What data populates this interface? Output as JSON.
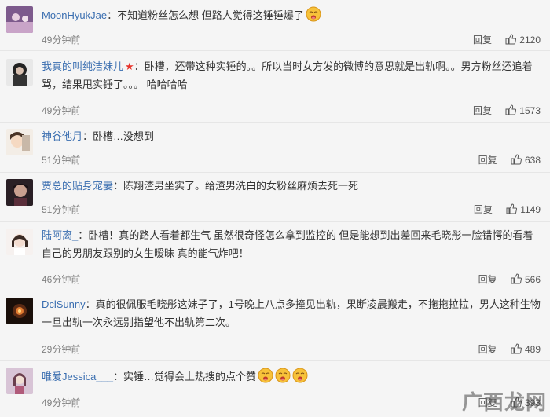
{
  "comments": [
    {
      "user": "MoonHyukJae",
      "text": "：不知道粉丝怎么想 但路人觉得这锤锤爆了",
      "time": "49分钟前",
      "reply": "回复",
      "likes": "2120",
      "emoji_count": 1
    },
    {
      "user": "我真的叫纯洁妹儿",
      "text": "：卧槽，还带这种实锤的。。所以当时女方发的微博的意思就是出轨啊。。男方粉丝还追着骂，结果甩实锤了。。。 哈哈哈哈",
      "time": "49分钟前",
      "reply": "回复",
      "likes": "1573",
      "badge": "★"
    },
    {
      "user": "神谷他月",
      "text": "：卧槽…没想到",
      "time": "51分钟前",
      "reply": "回复",
      "likes": "638"
    },
    {
      "user": "贾总的贴身宠妻",
      "text": "：陈翔渣男坐实了。给渣男洗白的女粉丝麻烦去死一死",
      "time": "51分钟前",
      "reply": "回复",
      "likes": "1149"
    },
    {
      "user": "陆阿离_",
      "text": "：卧槽！真的路人看着都生气 虽然很奇怪怎么拿到监控的 但是能想到出差回来毛晓彤一脸错愕的看着自己的男朋友跟别的女生暧昧 真的能气炸吧！",
      "time": "46分钟前",
      "reply": "回复",
      "likes": "566"
    },
    {
      "user": "DclSunny",
      "text": "：真的很佩服毛晓彤这妹子了，1号晚上八点多撞见出轨，果断凌晨搬走，不拖拖拉拉，男人这种生物一旦出轨一次永远别指望他不出轨第二次。",
      "time": "29分钟前",
      "reply": "回复",
      "likes": "489"
    },
    {
      "user": "唯爱Jessica___",
      "text": "：实锤…觉得会上热搜的点个赞",
      "time": "49分钟前",
      "reply": "回复",
      "likes": "393",
      "emoji_count": 3
    }
  ],
  "watermark": "广西龙网",
  "colors": {
    "username": "#3a6eb0",
    "background": "#f5f5f5",
    "badge": "#e8332b"
  }
}
